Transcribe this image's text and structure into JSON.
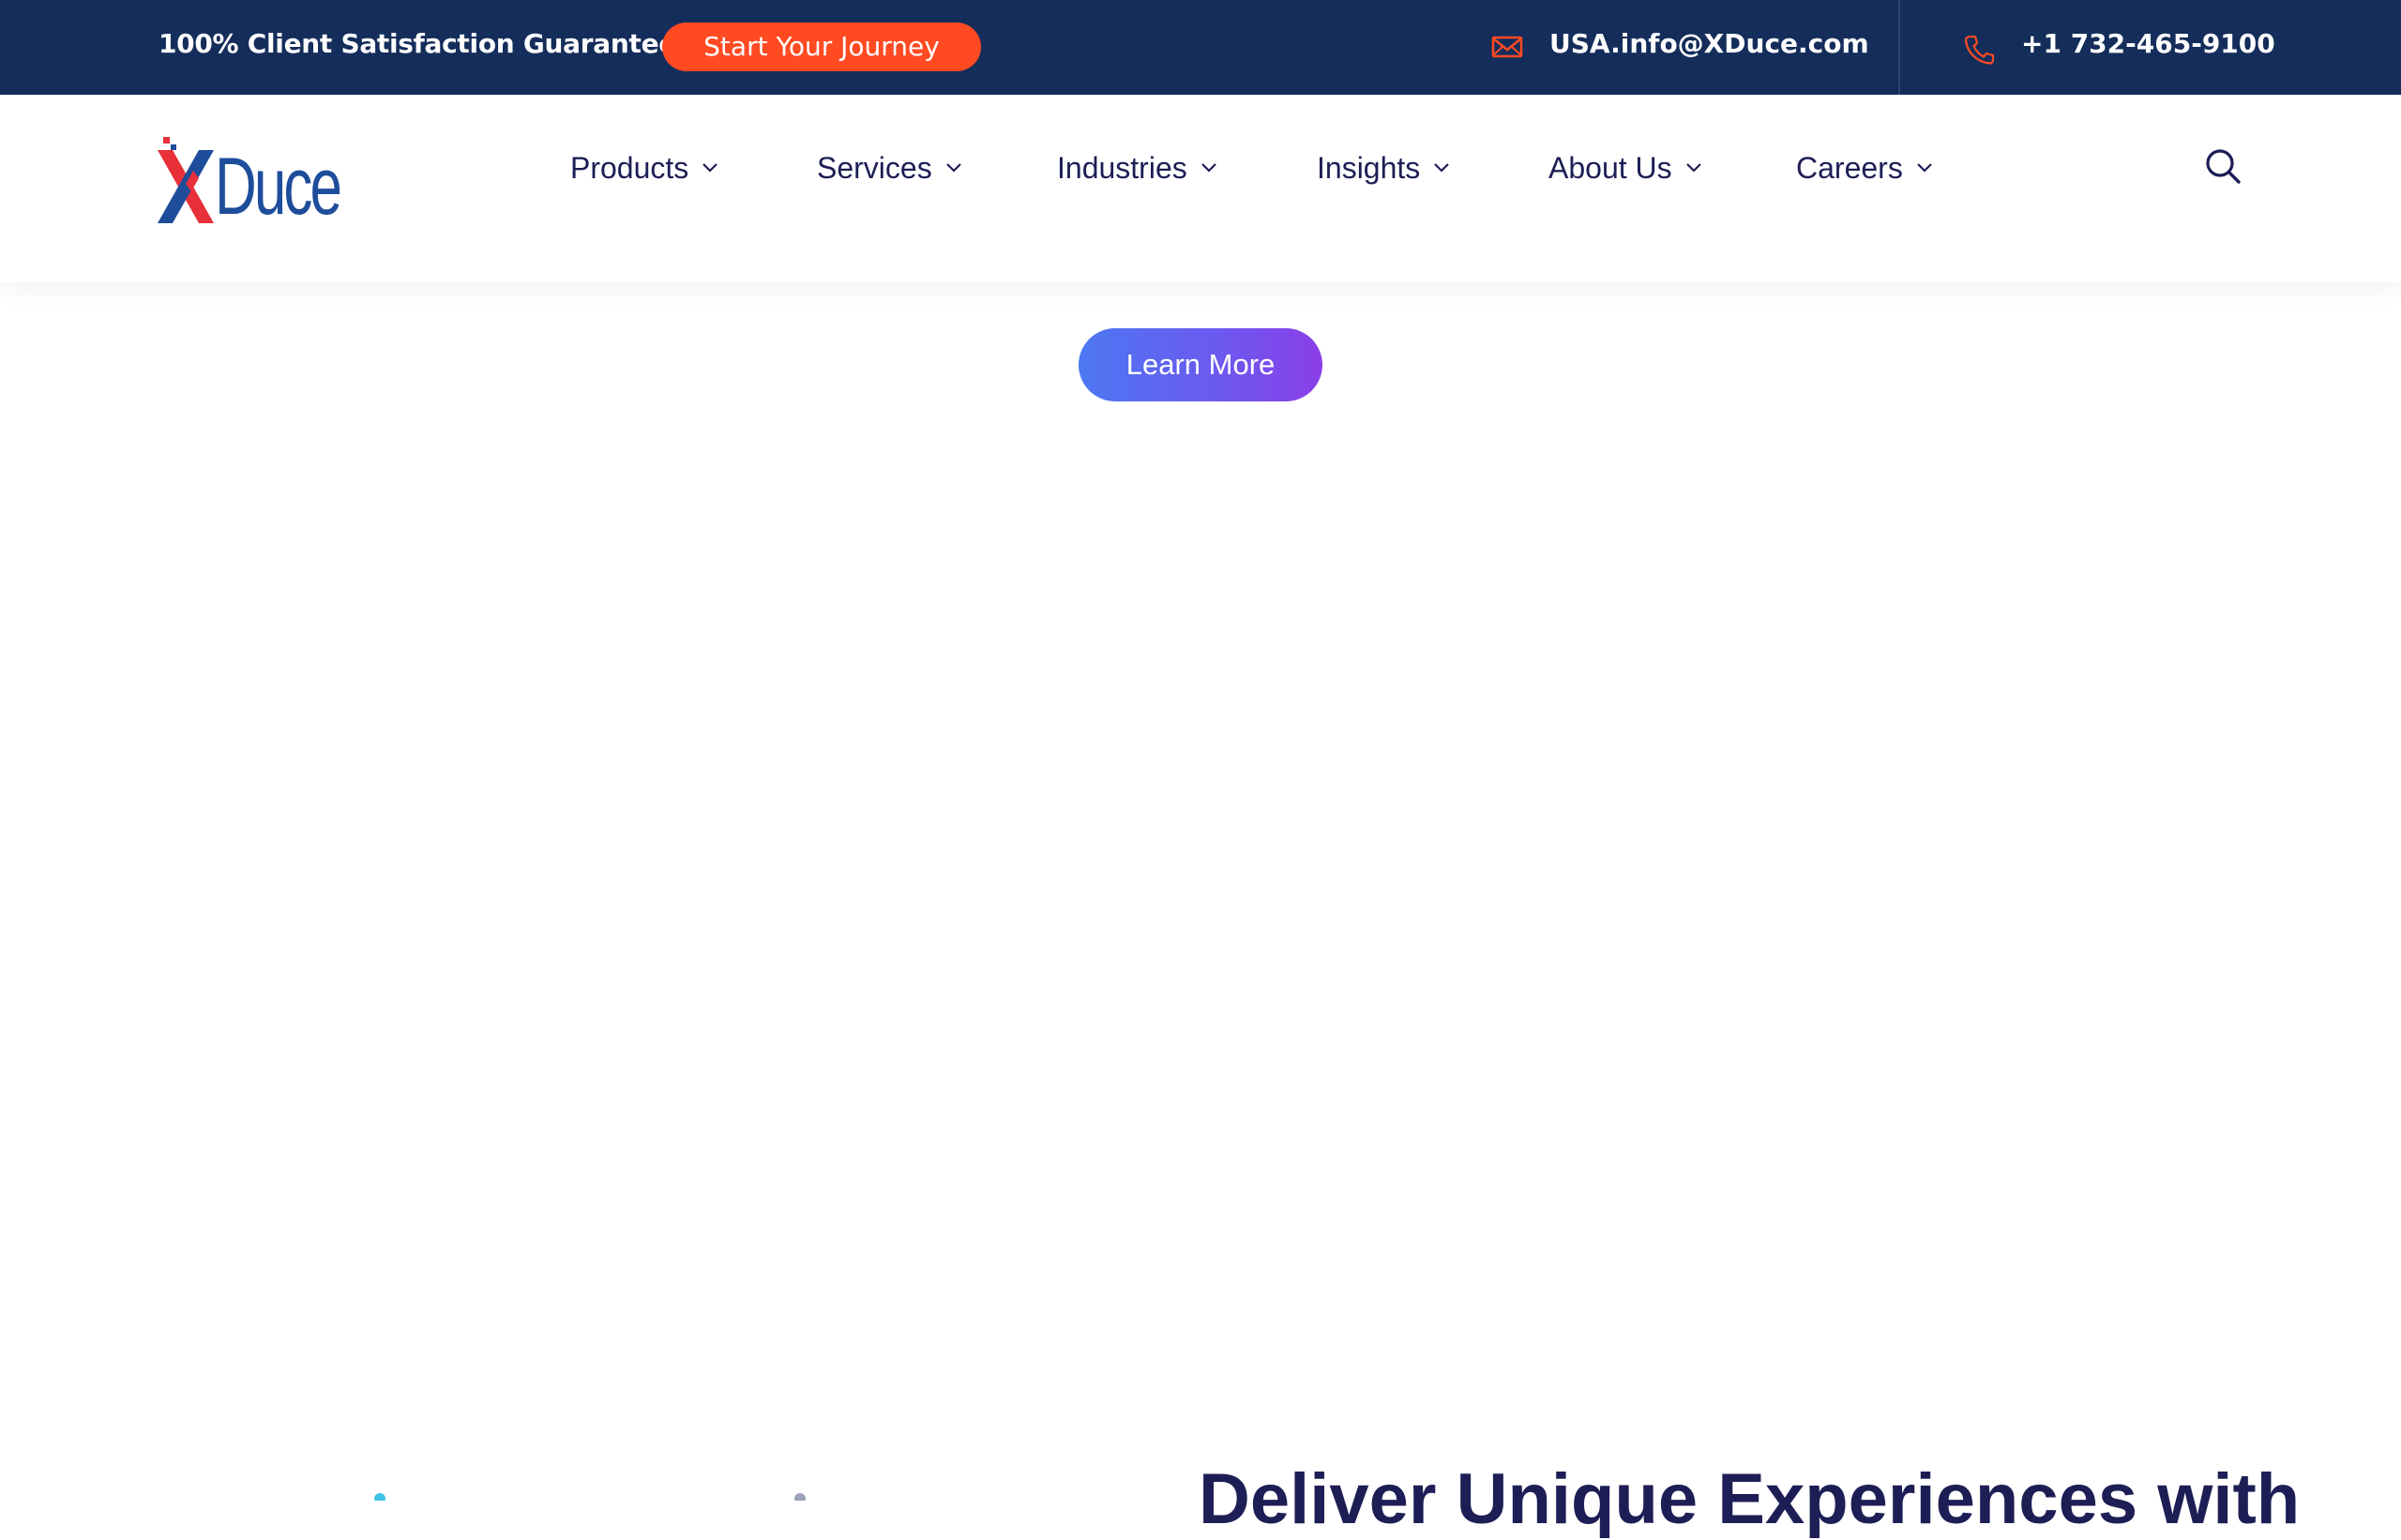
{
  "topbar": {
    "tagline": "100% Client Satisfaction Guaranteed",
    "cta_label": "Start Your Journey",
    "email": "USA.info@XDuce.com",
    "phone": "+1 732-465-9100",
    "mail_icon": "envelope-icon",
    "phone_icon": "phone-icon",
    "background": "#142d5a",
    "cta_color": "#ff4a22"
  },
  "header": {
    "logo_text": "XDuce",
    "nav": [
      {
        "label": "Products"
      },
      {
        "label": "Services"
      },
      {
        "label": "Industries"
      },
      {
        "label": "Insights"
      },
      {
        "label": "About Us"
      },
      {
        "label": "Careers"
      }
    ],
    "search_icon": "search-icon",
    "nav_color": "#1d1e55"
  },
  "content": {
    "learn_more_label": "Learn More",
    "bottom_heading": "Deliver Unique Experiences with"
  }
}
